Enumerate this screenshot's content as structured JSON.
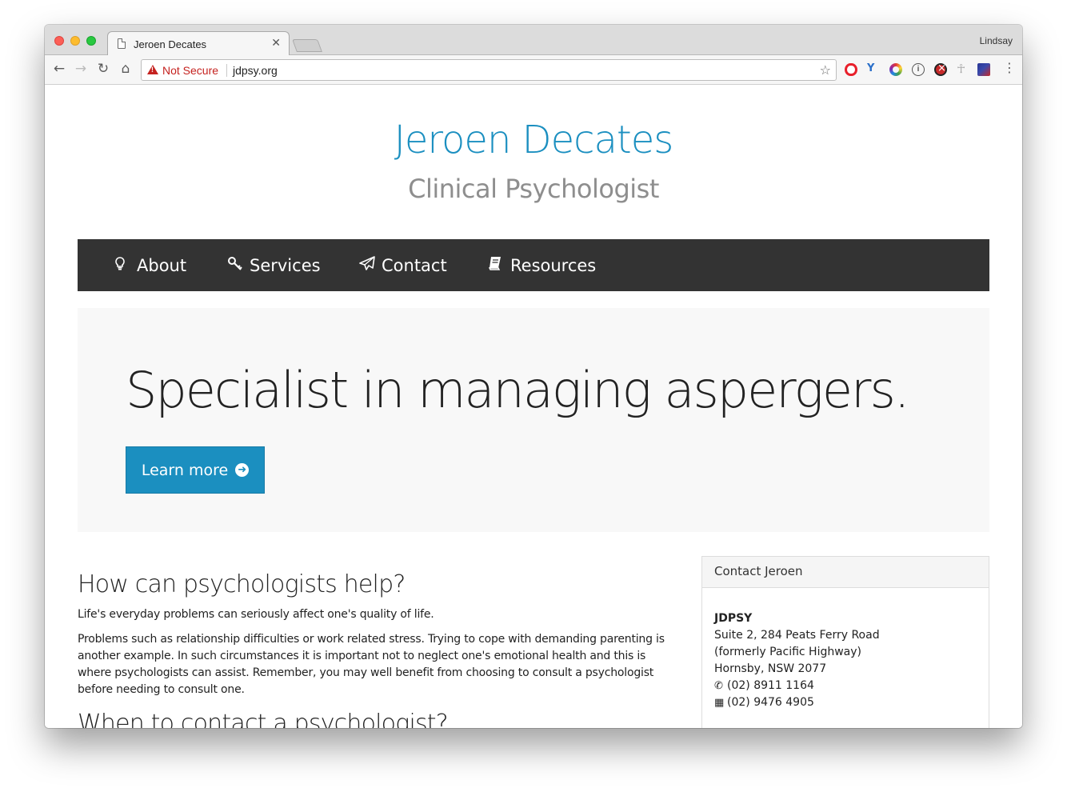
{
  "browser": {
    "tab_title": "Jeroen Decates",
    "profile_name": "Lindsay",
    "security_label": "Not Secure",
    "url": "jdpsy.org",
    "icons": [
      "back-icon",
      "forward-icon",
      "reload-icon",
      "home-icon",
      "warning-icon",
      "bookmark-star-icon",
      "opera-extension-icon",
      "y-extension-icon",
      "color-picker-extension-icon",
      "info-extension-icon",
      "blocker-extension-icon",
      "ankh-extension-icon",
      "image-extension-icon",
      "browser-menu-icon"
    ]
  },
  "site": {
    "title": "Jeroen Decates",
    "subtitle": "Clinical Psychologist",
    "accent_color": "#1b8fc0",
    "nav": [
      {
        "label": "About",
        "icon": "lightbulb-icon"
      },
      {
        "label": "Services",
        "icon": "key-icon"
      },
      {
        "label": "Contact",
        "icon": "paper-plane-icon"
      },
      {
        "label": "Resources",
        "icon": "book-icon"
      }
    ]
  },
  "hero": {
    "headline": "Specialist in managing aspergers.",
    "button_label": "Learn more"
  },
  "main": {
    "heading": "How can psychologists help?",
    "paragraphs": [
      "Life's everyday problems can seriously affect one's quality of life.",
      "Problems such as relationship difficulties or work related stress. Trying to cope with demanding parenting is another example. In such circumstances it is important not to neglect one's emotional health and this is where psychologists can assist. Remember, you may well benefit from choosing to consult a psychologist before needing to consult one."
    ],
    "next_heading": "When to contact a psychologist?"
  },
  "contact_card": {
    "header": "Contact Jeroen",
    "org": "JDPSY",
    "address_line1": "Suite 2, 284 Peats Ferry Road",
    "address_line2": "(formerly Pacific Highway)",
    "address_line3": "Hornsby, NSW 2077",
    "phone": "(02) 8911 1164",
    "fax": "(02) 9476 4905"
  }
}
